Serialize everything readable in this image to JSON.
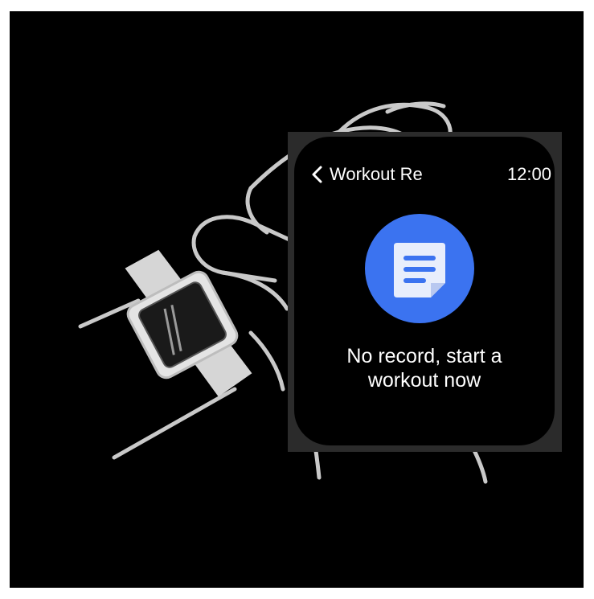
{
  "watch": {
    "title": "Workout Re",
    "time": "12:00",
    "empty_message_line1": "No record, start a",
    "empty_message_line2": "workout now",
    "icon": "document-icon",
    "accent_color": "#3b73f0"
  },
  "illustration": {
    "subject": "wrist-with-smartwatch-outline"
  }
}
